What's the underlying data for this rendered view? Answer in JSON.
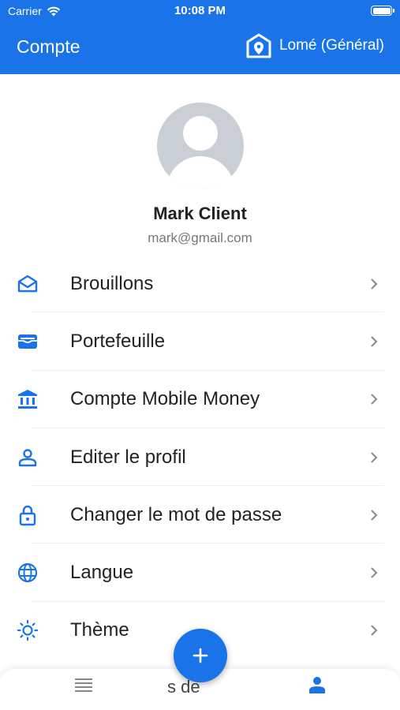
{
  "status_bar": {
    "carrier": "Carrier",
    "time": "10:08 PM"
  },
  "app_bar": {
    "title": "Compte",
    "location": "Lomé (Général)"
  },
  "profile": {
    "name": "Mark Client",
    "email": "mark@gmail.com"
  },
  "menu": [
    {
      "label": "Brouillons",
      "icon": "envelope-open-icon"
    },
    {
      "label": "Portefeuille",
      "icon": "wallet-icon"
    },
    {
      "label": "Compte Mobile Money",
      "icon": "bank-icon"
    },
    {
      "label": "Editer le profil",
      "icon": "person-icon"
    },
    {
      "label": "Changer le mot de passe",
      "icon": "lock-icon"
    },
    {
      "label": "Langue",
      "icon": "globe-icon"
    },
    {
      "label": "Thème",
      "icon": "sun-icon"
    }
  ],
  "bottom_nav": {
    "partial_label": "s de"
  },
  "colors": {
    "primary": "#1a73e8",
    "text": "#222222",
    "muted": "#777777"
  }
}
